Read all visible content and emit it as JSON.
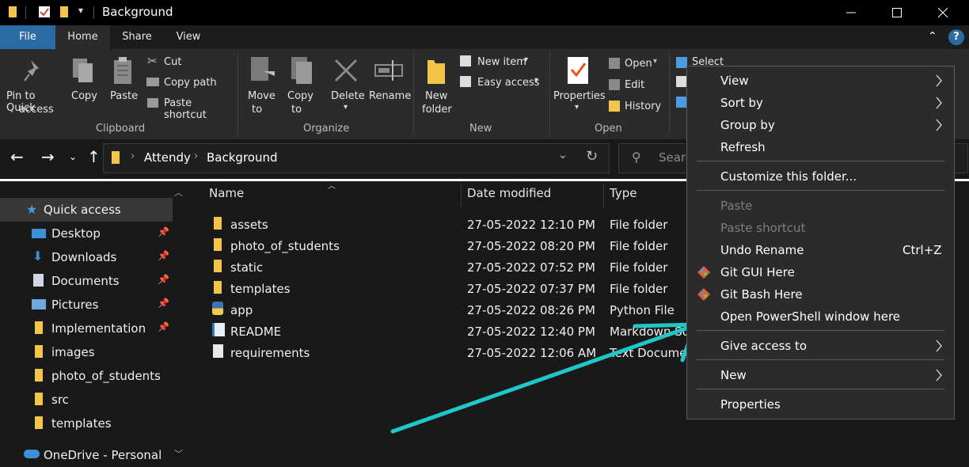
{
  "window": {
    "title": "Background",
    "controls": [
      "minimize",
      "maximize",
      "close"
    ]
  },
  "ribbon_tabs": [
    "File",
    "Home",
    "Share",
    "View"
  ],
  "ribbon": {
    "clipboard": {
      "pin": "Pin to Quick access",
      "pin_line1": "Pin to Quick",
      "pin_line2": "access",
      "copy": "Copy",
      "paste": "Paste",
      "cut": "Cut",
      "copy_path": "Copy path",
      "paste_shortcut": "Paste shortcut",
      "group": "Clipboard"
    },
    "organize": {
      "move_to_1": "Move",
      "move_to_2": "to",
      "copy_to_1": "Copy",
      "copy_to_2": "to",
      "delete": "Delete",
      "rename": "Rename",
      "group": "Organize"
    },
    "new": {
      "new_folder_1": "New",
      "new_folder_2": "folder",
      "new_item": "New item",
      "easy_access": "Easy access",
      "group": "New"
    },
    "open": {
      "properties": "Properties",
      "open": "Open",
      "edit": "Edit",
      "history": "History",
      "group": "Open"
    },
    "select": {
      "select_all": "Select all"
    }
  },
  "address": {
    "crumbs": [
      "Attendy",
      "Background"
    ],
    "search_placeholder": "Searc"
  },
  "navpane": {
    "items": [
      {
        "label": "Quick access",
        "pinned": false,
        "icon": "star-icon"
      },
      {
        "label": "Desktop",
        "pinned": true,
        "icon": "desktop-icon"
      },
      {
        "label": "Downloads",
        "pinned": true,
        "icon": "download-icon"
      },
      {
        "label": "Documents",
        "pinned": true,
        "icon": "document-icon"
      },
      {
        "label": "Pictures",
        "pinned": true,
        "icon": "pictures-icon"
      },
      {
        "label": "Implementation",
        "pinned": true,
        "icon": "folder-icon"
      },
      {
        "label": "images",
        "pinned": false,
        "icon": "folder-icon"
      },
      {
        "label": "photo_of_students",
        "pinned": false,
        "icon": "folder-icon"
      },
      {
        "label": "src",
        "pinned": false,
        "icon": "folder-icon"
      },
      {
        "label": "templates",
        "pinned": false,
        "icon": "folder-icon"
      },
      {
        "label": "OneDrive - Personal",
        "pinned": false,
        "icon": "cloud-icon"
      }
    ]
  },
  "filelist": {
    "columns": [
      "Name",
      "Date modified",
      "Type"
    ],
    "rows": [
      {
        "name": "assets",
        "date": "27-05-2022 12:10 PM",
        "type": "File folder",
        "icon": "folder-icon"
      },
      {
        "name": "photo_of_students",
        "date": "27-05-2022 08:20 PM",
        "type": "File folder",
        "icon": "folder-icon"
      },
      {
        "name": "static",
        "date": "27-05-2022 07:52 PM",
        "type": "File folder",
        "icon": "folder-icon"
      },
      {
        "name": "templates",
        "date": "27-05-2022 07:37 PM",
        "type": "File folder",
        "icon": "folder-icon"
      },
      {
        "name": "app",
        "date": "27-05-2022 08:26 PM",
        "type": "Python File",
        "icon": "python-file-icon"
      },
      {
        "name": "README",
        "date": "27-05-2022 12:40 PM",
        "type": "Markdown So",
        "icon": "markdown-file-icon"
      },
      {
        "name": "requirements",
        "date": "27-05-2022 12:06 AM",
        "type": "Text Documen",
        "icon": "text-file-icon"
      }
    ]
  },
  "context_menu": {
    "items": [
      {
        "label": "View",
        "submenu": true
      },
      {
        "label": "Sort by",
        "submenu": true
      },
      {
        "label": "Group by",
        "submenu": true
      },
      {
        "label": "Refresh"
      },
      {
        "label": "Customize this folder..."
      },
      {
        "label": "Paste",
        "disabled": true
      },
      {
        "label": "Paste shortcut",
        "disabled": true
      },
      {
        "label": "Undo Rename",
        "shortcut": "Ctrl+Z"
      },
      {
        "label": "Git GUI Here",
        "icon": "git-icon"
      },
      {
        "label": "Git Bash Here",
        "icon": "git-icon"
      },
      {
        "label": "Open PowerShell window here"
      },
      {
        "label": "Give access to",
        "submenu": true
      },
      {
        "label": "New",
        "submenu": true
      },
      {
        "label": "Properties"
      }
    ]
  },
  "colors": {
    "accent_file_tab": "#2a6aa5",
    "folder": "#f3c64b",
    "annotation_arrow": "#1fc7c7"
  }
}
